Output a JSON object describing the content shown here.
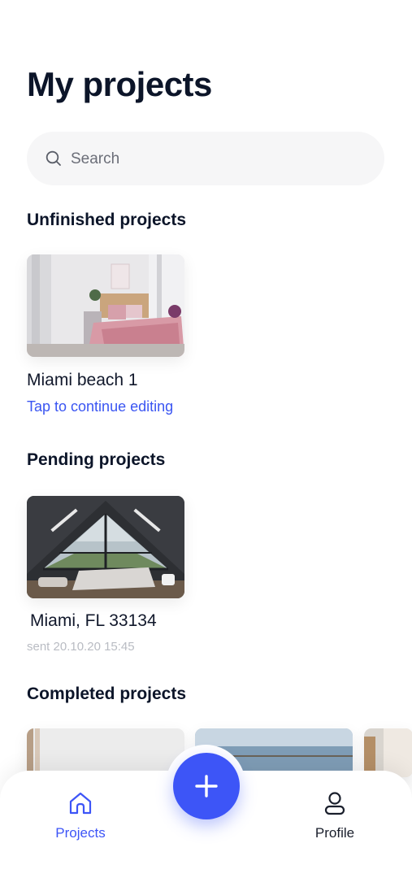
{
  "page": {
    "title": "My projects"
  },
  "search": {
    "placeholder": "Search",
    "icon": "search-icon"
  },
  "sections": {
    "unfinished": {
      "title": "Unfinished projects",
      "card": {
        "name": "Miami beach 1",
        "action": "Tap to continue editing"
      }
    },
    "pending": {
      "title": "Pending projects",
      "card": {
        "name": "Miami, FL 33134",
        "meta": "sent 20.10.20 15:45"
      }
    },
    "completed": {
      "title": "Completed projects"
    }
  },
  "nav": {
    "projects_label": "Projects",
    "profile_label": "Profile",
    "add_icon": "plus-icon"
  },
  "colors": {
    "accent": "#3d55f7",
    "link": "#3a55f2",
    "text": "#0c1529",
    "muted": "#b9bcc3"
  }
}
